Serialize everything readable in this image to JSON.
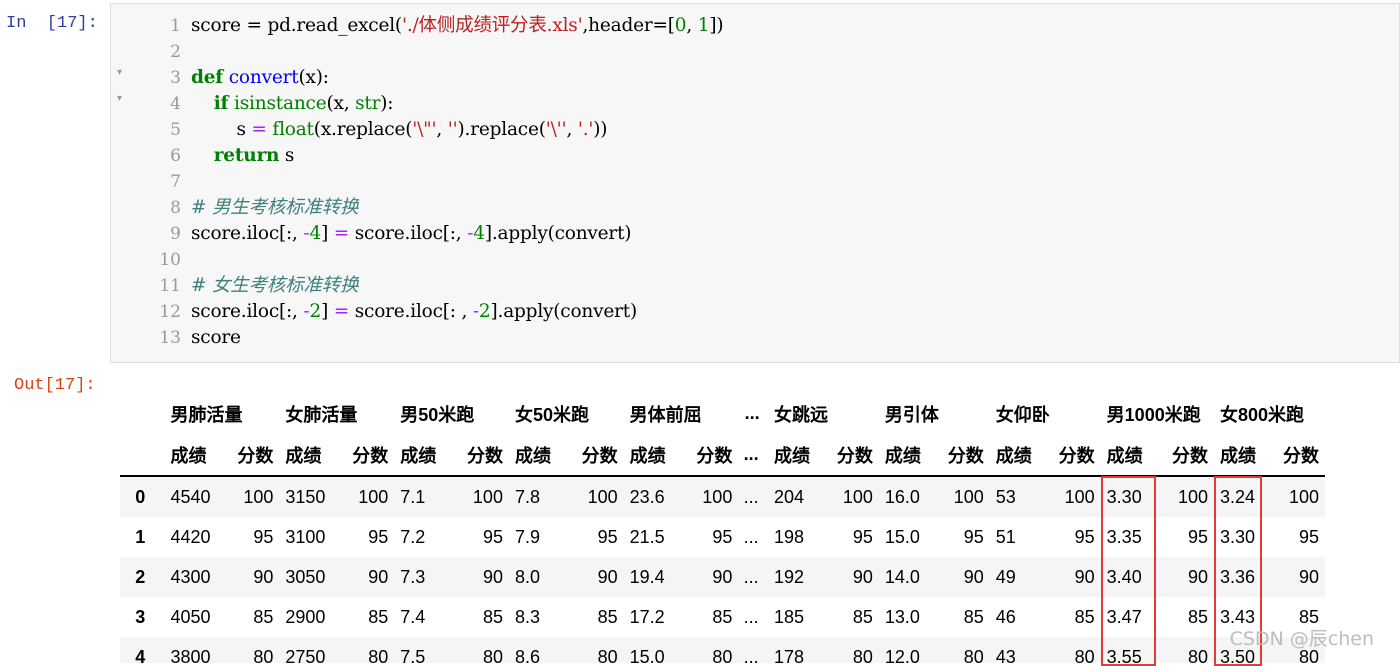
{
  "prompts": {
    "input": "In  [17]:",
    "output": "Out[17]:"
  },
  "code_lines": [
    {
      "n": "1",
      "fold": "",
      "tokens": [
        [
          "",
          "score = pd.read_excel("
        ],
        [
          "str",
          "'./体侧成绩评分表.xls'"
        ],
        [
          "",
          ",header=["
        ],
        [
          "num",
          "0"
        ],
        [
          "",
          ", "
        ],
        [
          "num",
          "1"
        ],
        [
          "",
          "])"
        ]
      ]
    },
    {
      "n": "2",
      "fold": "",
      "tokens": []
    },
    {
      "n": "3",
      "fold": "▾",
      "tokens": [
        [
          "kw",
          "def"
        ],
        [
          "",
          " "
        ],
        [
          "def",
          "convert"
        ],
        [
          "",
          "(x):"
        ]
      ]
    },
    {
      "n": "4",
      "fold": "▾",
      "tokens": [
        [
          "",
          "    "
        ],
        [
          "kw",
          "if"
        ],
        [
          "",
          " "
        ],
        [
          "bi",
          "isinstance"
        ],
        [
          "",
          "(x, "
        ],
        [
          "bi",
          "str"
        ],
        [
          "",
          "):"
        ]
      ]
    },
    {
      "n": "5",
      "fold": "",
      "tokens": [
        [
          "",
          "        s "
        ],
        [
          "op",
          "="
        ],
        [
          "",
          " "
        ],
        [
          "bi",
          "float"
        ],
        [
          "",
          "(x.replace("
        ],
        [
          "str",
          "'\\\"'"
        ],
        [
          "",
          ", "
        ],
        [
          "str",
          "''"
        ],
        [
          "",
          ").replace("
        ],
        [
          "str",
          "'\\''"
        ],
        [
          "",
          ", "
        ],
        [
          "str",
          "'.'"
        ],
        [
          "",
          "))"
        ]
      ]
    },
    {
      "n": "6",
      "fold": "",
      "tokens": [
        [
          "",
          "    "
        ],
        [
          "kw",
          "return"
        ],
        [
          "",
          " s"
        ]
      ]
    },
    {
      "n": "7",
      "fold": "",
      "tokens": []
    },
    {
      "n": "8",
      "fold": "",
      "tokens": [
        [
          "cm",
          "# 男生考核标准转换"
        ]
      ]
    },
    {
      "n": "9",
      "fold": "",
      "tokens": [
        [
          "",
          "score.iloc[:, "
        ],
        [
          "op",
          "-"
        ],
        [
          "num",
          "4"
        ],
        [
          "",
          "] "
        ],
        [
          "op",
          "="
        ],
        [
          "",
          " score.iloc[:, "
        ],
        [
          "op",
          "-"
        ],
        [
          "num",
          "4"
        ],
        [
          "",
          "].apply(convert)"
        ]
      ]
    },
    {
      "n": "10",
      "fold": "",
      "tokens": []
    },
    {
      "n": "11",
      "fold": "",
      "tokens": [
        [
          "cm",
          "# 女生考核标准转换"
        ]
      ]
    },
    {
      "n": "12",
      "fold": "",
      "tokens": [
        [
          "",
          "score.iloc[:, "
        ],
        [
          "op",
          "-"
        ],
        [
          "num",
          "2"
        ],
        [
          "",
          "] "
        ],
        [
          "op",
          "="
        ],
        [
          "",
          " score.iloc[: , "
        ],
        [
          "op",
          "-"
        ],
        [
          "num",
          "2"
        ],
        [
          "",
          "].apply(convert)"
        ]
      ]
    },
    {
      "n": "13",
      "fold": "",
      "tokens": [
        [
          "",
          "score"
        ]
      ]
    }
  ],
  "dataframe": {
    "groups": [
      "男肺活量",
      "女肺活量",
      "男50米跑",
      "女50米跑",
      "男体前屈",
      "...",
      "女跳远",
      "男引体",
      "女仰卧",
      "男1000米跑",
      "女800米跑"
    ],
    "sub_headers": [
      "成绩",
      "分数",
      "成绩",
      "分数",
      "成绩",
      "分数",
      "成绩",
      "分数",
      "成绩",
      "分数",
      "...",
      "成绩",
      "分数",
      "成绩",
      "分数",
      "成绩",
      "分数",
      "成绩",
      "分数",
      "成绩",
      "分数"
    ],
    "rows": [
      {
        "index": "0",
        "cells": [
          "4540",
          "100",
          "3150",
          "100",
          "7.1",
          "100",
          "7.8",
          "100",
          "23.6",
          "100",
          "...",
          "204",
          "100",
          "16.0",
          "100",
          "53",
          "100",
          "3.30",
          "100",
          "3.24",
          "100"
        ]
      },
      {
        "index": "1",
        "cells": [
          "4420",
          "95",
          "3100",
          "95",
          "7.2",
          "95",
          "7.9",
          "95",
          "21.5",
          "95",
          "...",
          "198",
          "95",
          "15.0",
          "95",
          "51",
          "95",
          "3.35",
          "95",
          "3.30",
          "95"
        ]
      },
      {
        "index": "2",
        "cells": [
          "4300",
          "90",
          "3050",
          "90",
          "7.3",
          "90",
          "8.0",
          "90",
          "19.4",
          "90",
          "...",
          "192",
          "90",
          "14.0",
          "90",
          "49",
          "90",
          "3.40",
          "90",
          "3.36",
          "90"
        ]
      },
      {
        "index": "3",
        "cells": [
          "4050",
          "85",
          "2900",
          "85",
          "7.4",
          "85",
          "8.3",
          "85",
          "17.2",
          "85",
          "...",
          "185",
          "85",
          "13.0",
          "85",
          "46",
          "85",
          "3.47",
          "85",
          "3.43",
          "85"
        ]
      },
      {
        "index": "4",
        "cells": [
          "3800",
          "80",
          "2750",
          "80",
          "7.5",
          "80",
          "8.6",
          "80",
          "15.0",
          "80",
          "...",
          "178",
          "80",
          "12.0",
          "80",
          "43",
          "80",
          "3.55",
          "80",
          "3.50",
          "80"
        ]
      }
    ]
  },
  "highlight_color": "#e53935",
  "watermark": "CSDN @辰chen"
}
